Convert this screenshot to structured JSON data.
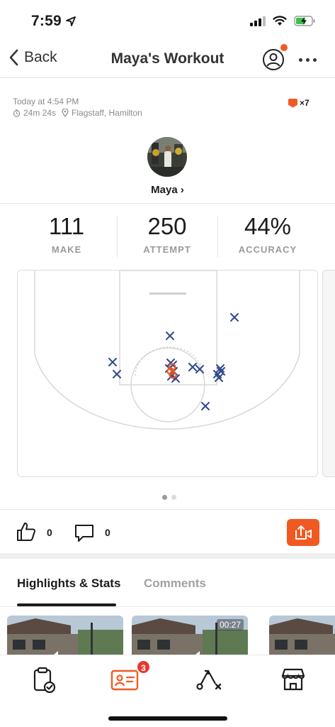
{
  "status_bar": {
    "time": "7:59"
  },
  "nav": {
    "back_label": "Back",
    "title": "Maya's Workout"
  },
  "meta": {
    "date": "Today at 4:54 PM",
    "duration": "24m 24s",
    "location": "Flagstaff, Hamilton",
    "badge_count": "×7"
  },
  "user": {
    "name": "Maya",
    "name_chevron": "›"
  },
  "stats": [
    {
      "value": "111",
      "label": "MAKE"
    },
    {
      "value": "250",
      "label": "ATTEMPT"
    },
    {
      "value": "44%",
      "label": "ACCURACY"
    }
  ],
  "social": {
    "likes": "0",
    "comments": "0"
  },
  "tabs": {
    "active": "Highlights & Stats",
    "inactive": "Comments"
  },
  "thumbnails": [
    {
      "duration": ""
    },
    {
      "duration": "00:27"
    },
    {
      "duration": ""
    }
  ],
  "tabbar": {
    "badge": "3"
  },
  "colors": {
    "accent": "#f05a22",
    "miss": "#2e4a8c",
    "badge": "#e63a2e"
  },
  "icons": [
    "location-arrow-icon",
    "signal-icon",
    "wifi-icon",
    "battery-charging-icon",
    "chevron-left-icon",
    "profile-icon",
    "more-icon",
    "timer-icon",
    "location-pin-icon",
    "thumbs-up-icon",
    "comment-icon",
    "share-video-icon",
    "clipboard-check-icon",
    "id-card-icon",
    "play-diagram-icon",
    "store-icon"
  ]
}
